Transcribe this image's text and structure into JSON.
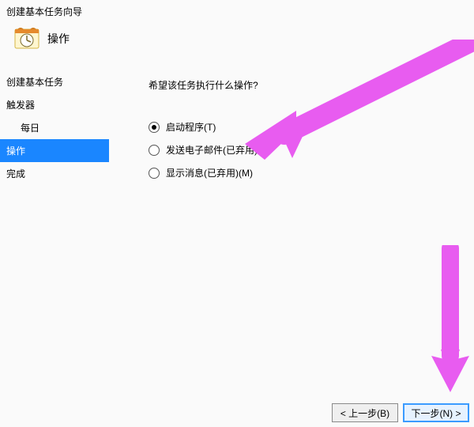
{
  "header": {
    "wizard_title": "创建基本任务向导",
    "page_heading": "操作"
  },
  "sidebar": {
    "items": [
      {
        "label": "创建基本任务",
        "indent": false,
        "selected": false
      },
      {
        "label": "触发器",
        "indent": false,
        "selected": false
      },
      {
        "label": "每日",
        "indent": true,
        "selected": false
      },
      {
        "label": "操作",
        "indent": false,
        "selected": true
      },
      {
        "label": "完成",
        "indent": false,
        "selected": false
      }
    ]
  },
  "content": {
    "question": "希望该任务执行什么操作?",
    "options": [
      {
        "label": "启动程序(T)",
        "checked": true
      },
      {
        "label": "发送电子邮件(已弃用)(S)",
        "checked": false
      },
      {
        "label": "显示消息(已弃用)(M)",
        "checked": false
      }
    ]
  },
  "footer": {
    "back_label": "< 上一步(B)",
    "next_label": "下一步(N) >"
  },
  "annotation": {
    "arrow_color": "#e85cf0"
  }
}
